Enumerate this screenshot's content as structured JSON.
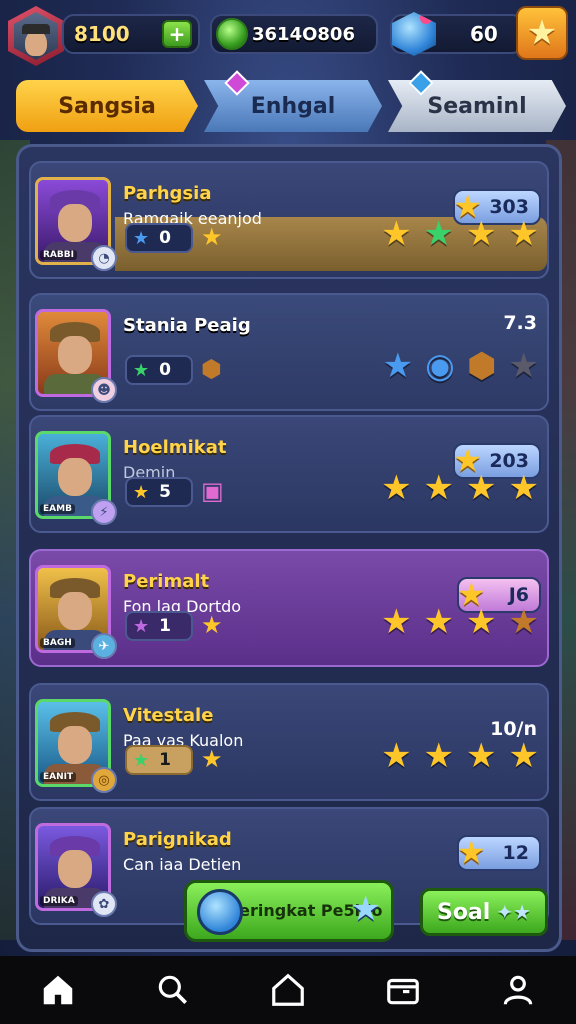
{
  "topbar": {
    "coins": "8100",
    "gems": "3614O806",
    "tokens": "60"
  },
  "tabs": [
    {
      "label": "Sangsia"
    },
    {
      "label": "Enhgal"
    },
    {
      "label": "Seaminl"
    }
  ],
  "rows": [
    {
      "title": "Parhgsia",
      "subtitle": "Ramgaik eeanjod",
      "tag": "RABBI",
      "score": "303",
      "level": "0"
    },
    {
      "title": "Stania Peaig",
      "subtitle": "",
      "score": "7.3",
      "level": "0"
    },
    {
      "title": "Hoelmikat",
      "subtitle": "Demin",
      "tag": "EAMB",
      "score": "203",
      "level": "5"
    },
    {
      "title": "Perimalt",
      "subtitle": "Fon lag Dortdo",
      "tag": "BAGH",
      "score": "J6",
      "level": "1"
    },
    {
      "title": "Vitestale",
      "subtitle": "Paa yas Kualon",
      "tag": "EANIT",
      "score": "10/n",
      "level": "1"
    },
    {
      "title": "Parignikad",
      "subtitle": "Can iaa Detien",
      "tag": "DRIKA",
      "score": "12"
    }
  ],
  "actions": {
    "main_label": "Peringkat Pe5ido",
    "soal_label": "Soal"
  },
  "icons": {
    "nav": [
      "home-icon",
      "search-icon",
      "house-outline-icon",
      "folder-icon",
      "profile-icon"
    ]
  },
  "colors": {
    "accent_gold": "#ffd34a",
    "accent_green": "#3da81e",
    "panel_bg": "#2a3560"
  }
}
